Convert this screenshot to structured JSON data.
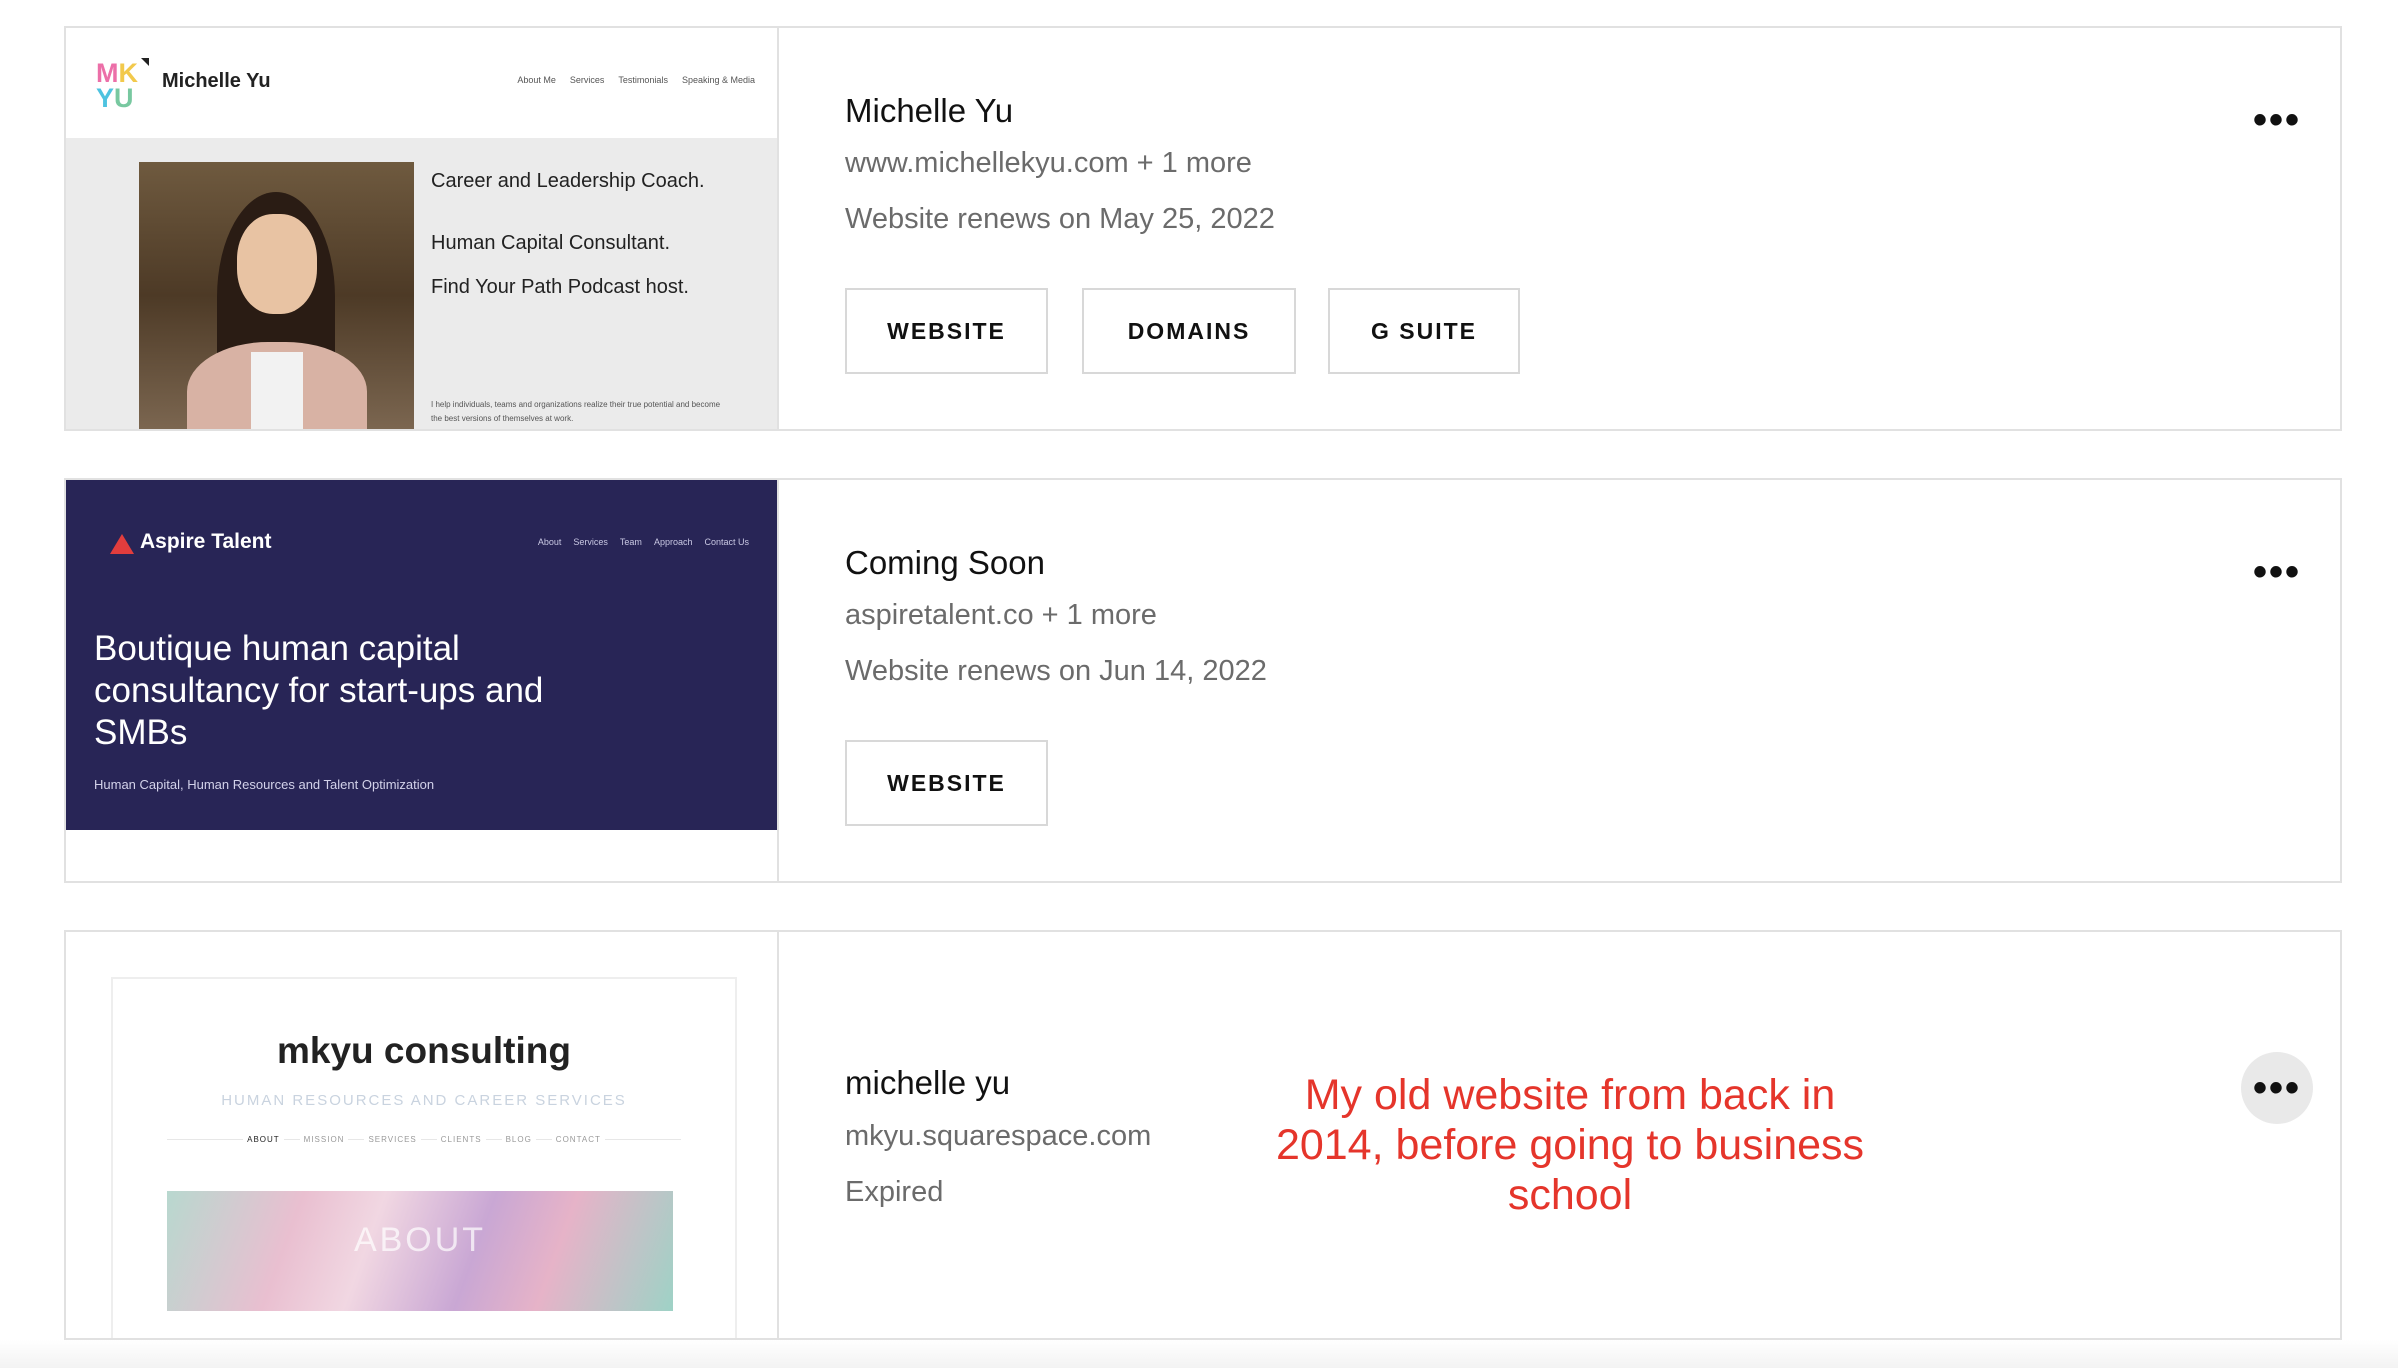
{
  "sites": [
    {
      "title": "Michelle Yu",
      "domain_line": "www.michellekyu.com + 1 more",
      "status_line": "Website renews on May 25, 2022",
      "buttons": [
        "WEBSITE",
        "DOMAINS",
        "G SUITE"
      ],
      "menu_icon": "more-horizontal-icon",
      "preview": {
        "logo_letters": [
          "MK",
          "YU"
        ],
        "brand": "Michelle Yu",
        "nav": [
          "About Me",
          "Services",
          "Testimonials",
          "Speaking & Media"
        ],
        "lines": [
          "Career and Leadership Coach.",
          "Human Capital Consultant.",
          "Find Your Path Podcast host."
        ],
        "small": "I help individuals, teams and organizations realize their true potential and become the best versions of themselves at work."
      }
    },
    {
      "title": "Coming Soon",
      "domain_line": "aspiretalent.co + 1 more",
      "status_line": "Website renews on Jun 14, 2022",
      "buttons": [
        "WEBSITE"
      ],
      "menu_icon": "more-horizontal-icon",
      "preview": {
        "brand": "Aspire Talent",
        "nav": [
          "About",
          "Services",
          "Team",
          "Approach",
          "Contact Us"
        ],
        "headline": "Boutique human capital consultancy for start-ups and SMBs",
        "subline": "Human Capital, Human Resources and Talent Optimization"
      }
    },
    {
      "title": "michelle yu",
      "domain_line": "mkyu.squarespace.com",
      "status_line": "Expired",
      "buttons": [],
      "menu_icon": "more-horizontal-icon",
      "preview": {
        "brand": "mkyu consulting",
        "tagline": "HUMAN RESOURCES AND CAREER SERVICES",
        "nav": [
          "ABOUT",
          "MISSION",
          "SERVICES",
          "CLIENTS",
          "BLOG",
          "CONTACT"
        ],
        "image_label": "ABOUT"
      }
    }
  ],
  "annotation": "My old website from back in 2014, before going to business school",
  "colors": {
    "annotation": "#e5352b",
    "aspire_bg": "#282556",
    "border": "#e1e1e1",
    "muted_text": "#6b6b6b"
  }
}
